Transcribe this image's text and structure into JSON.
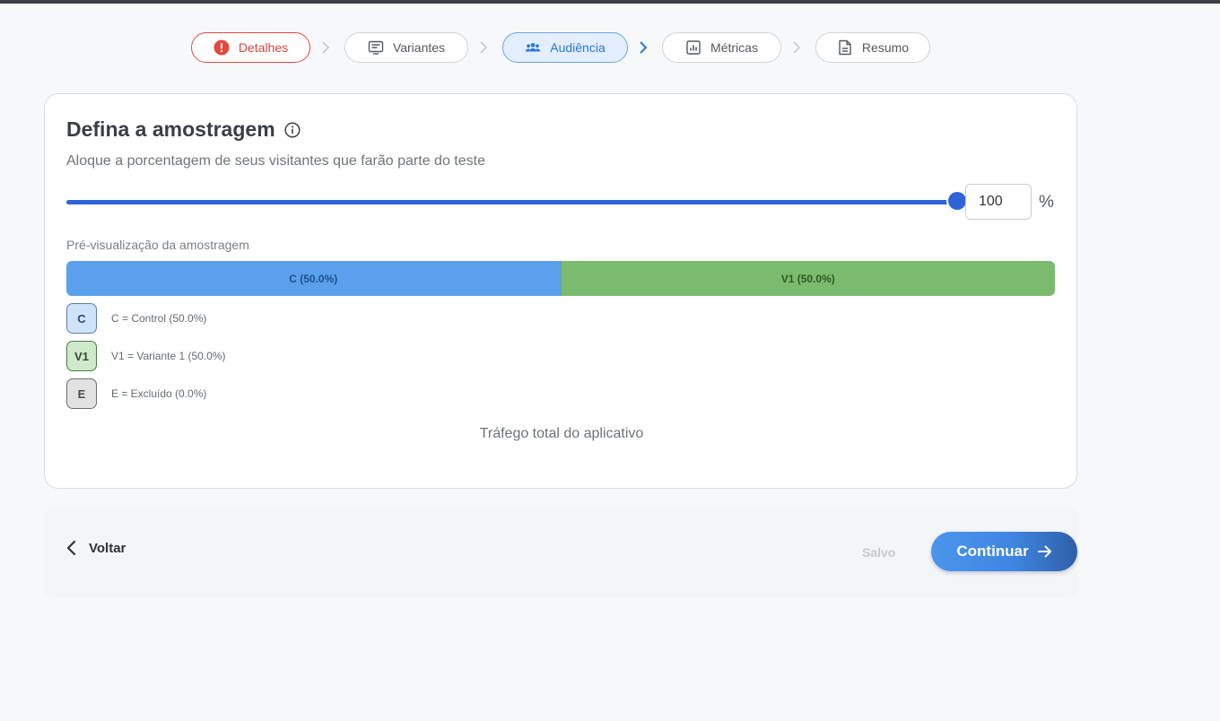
{
  "stepper": {
    "steps": [
      {
        "label": "Detalhes",
        "icon": "alert-icon",
        "state": "error"
      },
      {
        "label": "Variantes",
        "icon": "variants-icon",
        "state": "default"
      },
      {
        "label": "Audiência",
        "icon": "audience-icon",
        "state": "active"
      },
      {
        "label": "Métricas",
        "icon": "chart-icon",
        "state": "default"
      },
      {
        "label": "Resumo",
        "icon": "document-icon",
        "state": "default"
      }
    ]
  },
  "sampling": {
    "title": "Defina a amostragem",
    "subtitle": "Aloque a porcentagem de seus visitantes que farão parte do teste",
    "percent_value": "100",
    "percent_sign": "%",
    "slider_level": 1.0,
    "preview_label": "Pré-visualização da amostragem",
    "bar": [
      {
        "label": "C (50.0%)",
        "share": 50.0,
        "color": "#5aa0ec"
      },
      {
        "label": "V1 (50.0%)",
        "share": 50.0,
        "color": "#7bbb6e"
      }
    ],
    "legend": [
      {
        "badge": "C",
        "text": "C = Control (50.0%)"
      },
      {
        "badge": "V1",
        "text": "V1 = Variante 1 (50.0%)"
      },
      {
        "badge": "E",
        "text": "E = Excluído (0.0%)"
      }
    ],
    "traffic_label": "Tráfego total do aplicativo"
  },
  "footer": {
    "back_label": "Voltar",
    "saved_label": "Salvo",
    "continue_label": "Continuar"
  },
  "colors": {
    "accent": "#2f63d8",
    "error": "#e4483e",
    "active_step_bg": "#e3efff"
  }
}
